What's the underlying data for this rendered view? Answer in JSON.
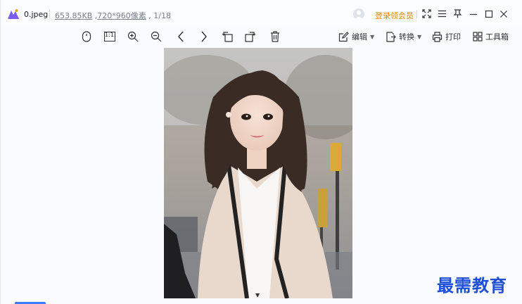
{
  "title_bar": {
    "file_name": "0.jpeg",
    "file_size": "653.85KB",
    "dimensions": "720*960像素",
    "page_index": "1/18",
    "login_label": "登录领会员"
  },
  "toolbar": {
    "edit_label": "编辑",
    "convert_label": "转换",
    "print_label": "打印",
    "toolbox_label": "工具箱",
    "actual_size_label": "1:1"
  },
  "watermark": "最需教育",
  "colors": {
    "accent_orange": "#f08a00",
    "watermark_blue": "#1d4fd6",
    "tab_blue": "#3b7bff"
  }
}
